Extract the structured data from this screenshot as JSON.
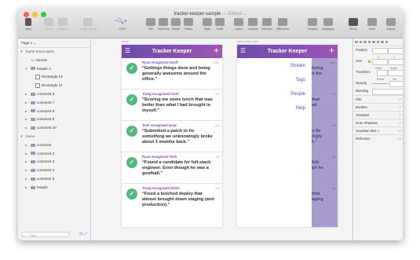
{
  "window": {
    "title": "tracker-keeper-sample",
    "status": "— Edited ⌄",
    "colors": {
      "close": "#fc605c",
      "minimize": "#fdbc40",
      "maximize": "#34c84a",
      "accent": "#7b4fb3",
      "check": "#56b67f"
    }
  },
  "toolbar": {
    "insert": "Insert",
    "group": "Group",
    "ungroup": "Ungroup",
    "create_symbol": "Create Symbol",
    "zoom": "100%",
    "edit": "Edit",
    "transform": "Transform",
    "rotate": "Rotate",
    "flatten": "Flatten",
    "mask": "Mask",
    "scale": "Scale",
    "union": "Union",
    "subtract": "Subtract",
    "intersect": "Intersect",
    "difference": "Difference",
    "forward": "Forward",
    "backward": "Backward",
    "mirror": "Mirror",
    "view": "View",
    "export": "Export"
  },
  "sidebar": {
    "page": "Page 1",
    "layers": [
      {
        "label": "home-menu-open",
        "kind": "artboard",
        "level": 0,
        "open": true
      },
      {
        "label": "Stream",
        "kind": "text",
        "level": 1
      },
      {
        "label": "header 2",
        "kind": "group",
        "level": 1
      },
      {
        "label": "Rectangle 13",
        "kind": "rect",
        "level": 2
      },
      {
        "label": "Rectangle 14",
        "kind": "rect",
        "level": 2
      },
      {
        "label": "comment 6",
        "kind": "group",
        "level": 1
      },
      {
        "label": "comment 7",
        "kind": "group",
        "level": 1
      },
      {
        "label": "comment 8",
        "kind": "group",
        "level": 1
      },
      {
        "label": "comment 9",
        "kind": "group",
        "level": 1
      },
      {
        "label": "comment 10",
        "kind": "group",
        "level": 1
      },
      {
        "label": "home",
        "kind": "artboard",
        "level": 0,
        "open": true
      },
      {
        "label": "comment",
        "kind": "group",
        "level": 1
      },
      {
        "label": "comment 2",
        "kind": "group",
        "level": 1
      },
      {
        "label": "comment 3",
        "kind": "group",
        "level": 1
      },
      {
        "label": "comment 4",
        "kind": "group",
        "level": 1
      },
      {
        "label": "comment 5",
        "kind": "group",
        "level": 1
      },
      {
        "label": "header",
        "kind": "group",
        "level": 1
      }
    ],
    "filter_placeholder": "Filter"
  },
  "canvas": {
    "artboard1_label": "home",
    "artboard2_label": "home-menu-open",
    "app_title": "Tracker Keeper",
    "cards": [
      {
        "recognizer": "Ryan recognized Geoff",
        "time": "12m",
        "quote": "“Gettings things done and being generally awesome around the office.”"
      },
      {
        "recognizer": "Trung recognized Clark",
        "time": "1d",
        "quote": "“Scoring me some lunch that was better than what I had brought in myself.”"
      },
      {
        "recognizer": "Tesh recognized Isaac",
        "time": "1d",
        "quote": "“Submitted a patch to fix something we unknowingly broke about 3 months back.”"
      },
      {
        "recognizer": "Ryan recognized Tesh",
        "time": "2d",
        "quote": "“Found a candidate for full-stack engineer. Even though he was a goofball.”"
      },
      {
        "recognizer": "Trung recognized Nitish",
        "time": "2d",
        "quote": "“Fixed a botched deploy that almost brought down staging (and production).”"
      }
    ],
    "menu_items": [
      "Stream",
      "Tags",
      "People",
      "Help"
    ],
    "peek": [
      {
        "time": "12m",
        "lines": [
          "being",
          "d the"
        ]
      },
      {
        "time": "1d",
        "lines": [
          "that",
          "ad"
        ]
      },
      {
        "time": "1d",
        "lines": [
          "o fix",
          "ingly",
          "k.\""
        ]
      },
      {
        "time": "2d",
        "lines": [
          "full-",
          "gh he"
        ]
      },
      {
        "time": "2d",
        "lines": [
          "that",
          "aging"
        ]
      }
    ]
  },
  "inspector": {
    "position": "Position",
    "x": "X",
    "y": "Y",
    "size": "Size",
    "width": "Width",
    "height": "Height",
    "transform": "Transform",
    "rotate": "Rotate",
    "flip": "Flip",
    "opacity": "Opacity",
    "blending": "Blending",
    "fills": "Fills",
    "borders": "Borders",
    "shadows": "Shadows",
    "inner_shadows": "Inner Shadows",
    "gaussian_blur": "Gaussian Blur ◇",
    "reflection": "Reflection"
  }
}
